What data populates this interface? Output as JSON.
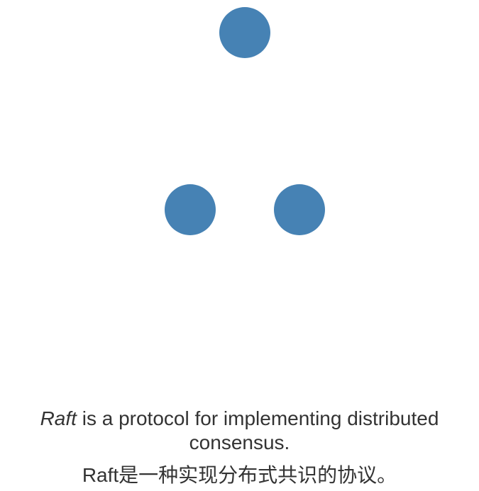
{
  "diagram": {
    "node_color": "#4682b4",
    "nodes": [
      {
        "id": "top"
      },
      {
        "id": "left"
      },
      {
        "id": "right"
      }
    ]
  },
  "caption": {
    "title_word": "Raft",
    "english_rest": " is a protocol for implementing distributed consensus.",
    "chinese": "Raft是一种实现分布式共识的协议。"
  }
}
